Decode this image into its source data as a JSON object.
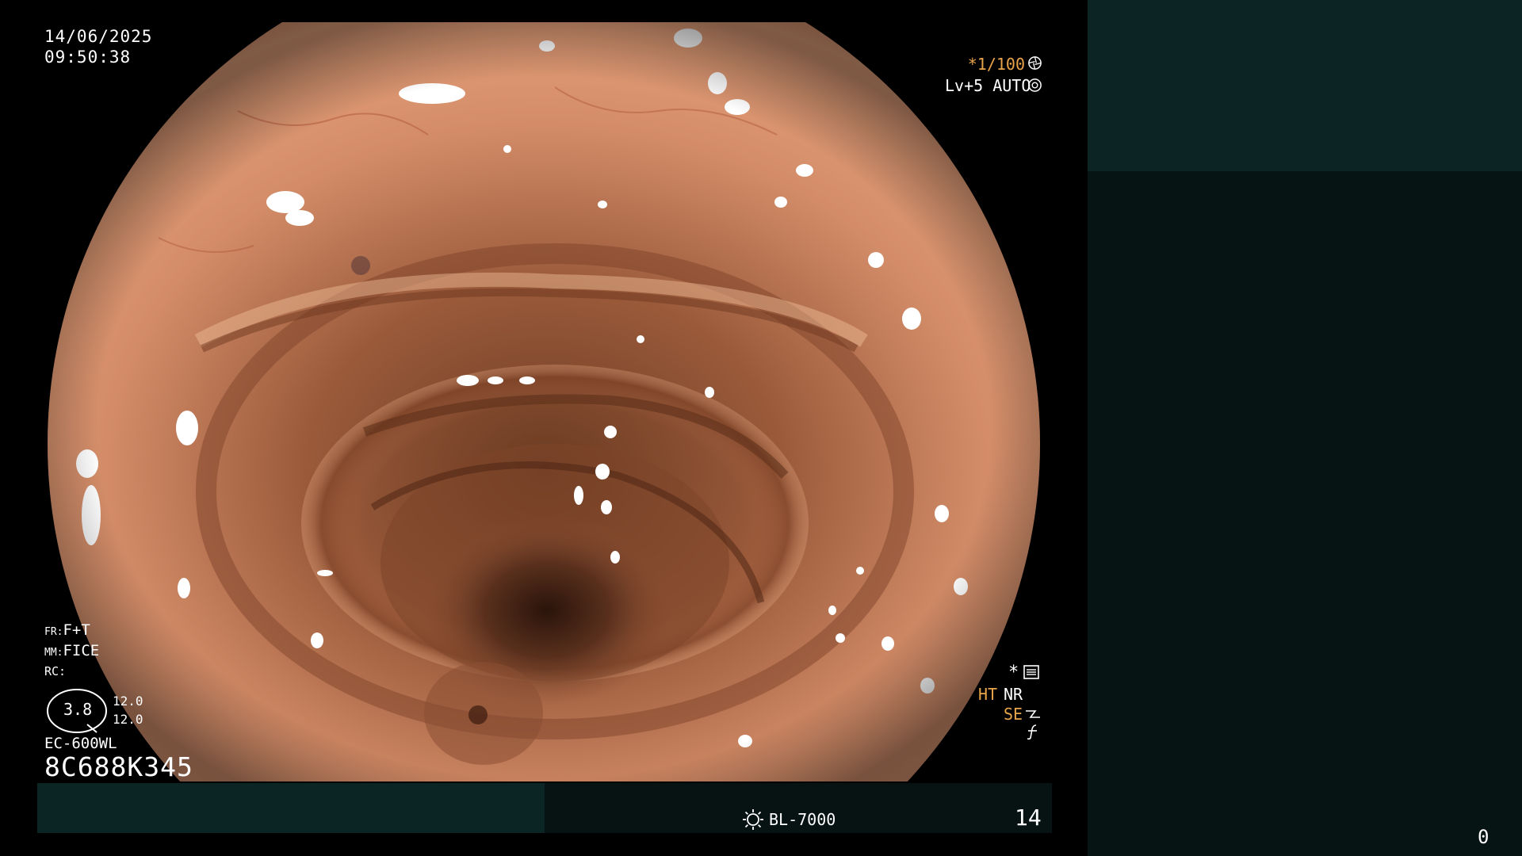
{
  "overlay": {
    "date": "14/06/2025",
    "time": "09:50:38",
    "shutter": "*1/100",
    "shutter_icon": "aperture-icon",
    "level": "Lv+5 AUTO",
    "auto_icon": "auto-exposure-icon",
    "fr_label": "FR:",
    "fr_value": "F+T",
    "mm_label": "MM:",
    "mm_value": "FICE",
    "rc_label": "RC:",
    "zoom_value": "3.8",
    "zoom_a": "12.0",
    "zoom_b": "12.0",
    "scope_model": "EC-600WL",
    "scope_serial": "8C688K345",
    "star": "*",
    "menu_icon": "settings-list-icon",
    "ht": "HT",
    "nr": "NR",
    "se": "SE",
    "se_icon": "structure-enhance-icon",
    "f_icon": "function-icon"
  },
  "bottom_bar": {
    "light_icon": "light-source-icon",
    "light_source": "BL-7000",
    "image_count": "14"
  },
  "side_panel": {
    "counter": "0"
  },
  "colors": {
    "accent_orange": "#e8a44a",
    "panel_dark": "#071414",
    "panel_teal": "#0c2424"
  }
}
